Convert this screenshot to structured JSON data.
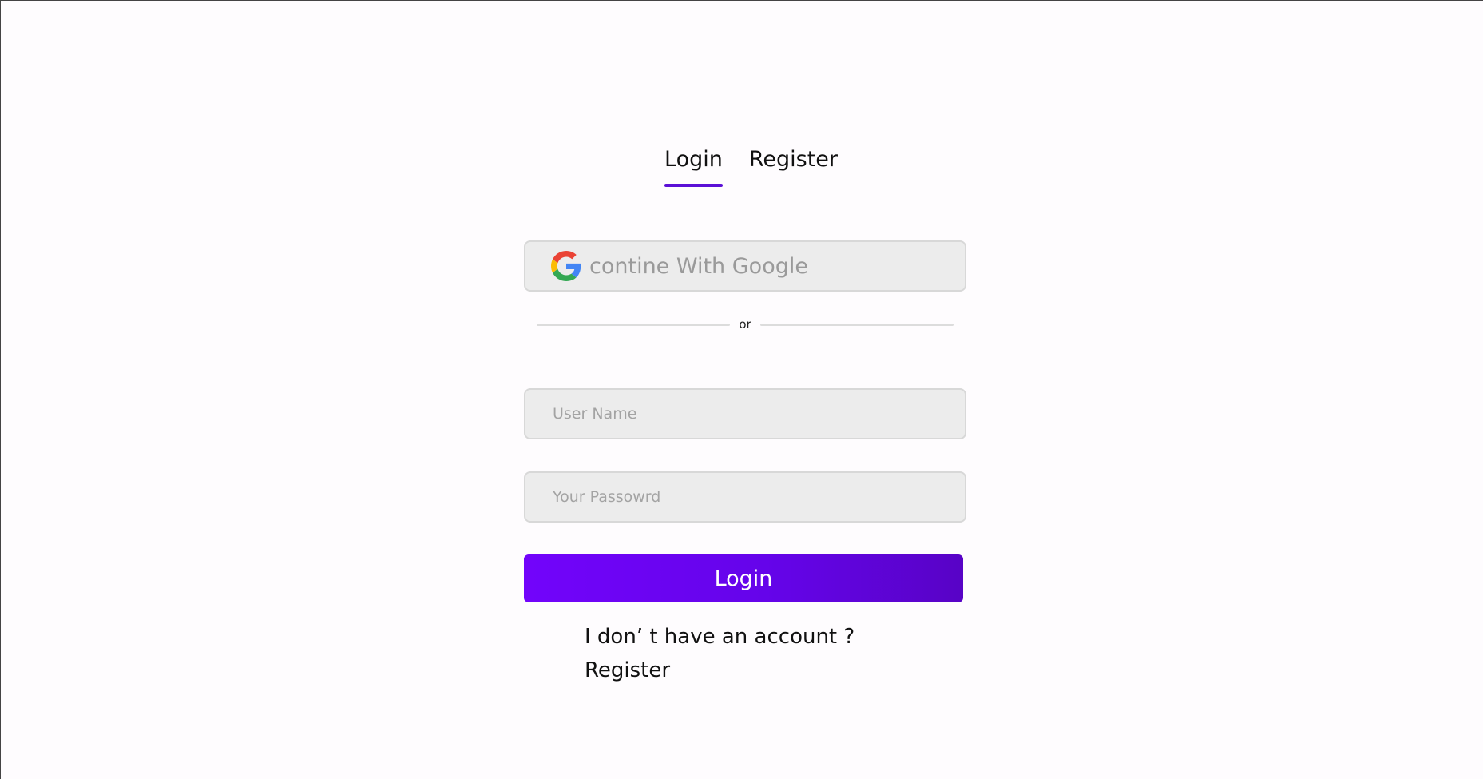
{
  "tabs": {
    "login_label": "Login",
    "register_label": "Register",
    "active": "login",
    "active_underline_color": "#5b10d6"
  },
  "google_button": {
    "label": "contine With Google",
    "icon": "google-icon"
  },
  "divider": {
    "text": "or"
  },
  "form": {
    "username_placeholder": "User Name",
    "password_placeholder": "Your Passowrd",
    "submit_label": "Login",
    "submit_color": "#6a04f0"
  },
  "footer": {
    "no_account_text": "I don’ t have an account ?",
    "register_link": "Register"
  }
}
